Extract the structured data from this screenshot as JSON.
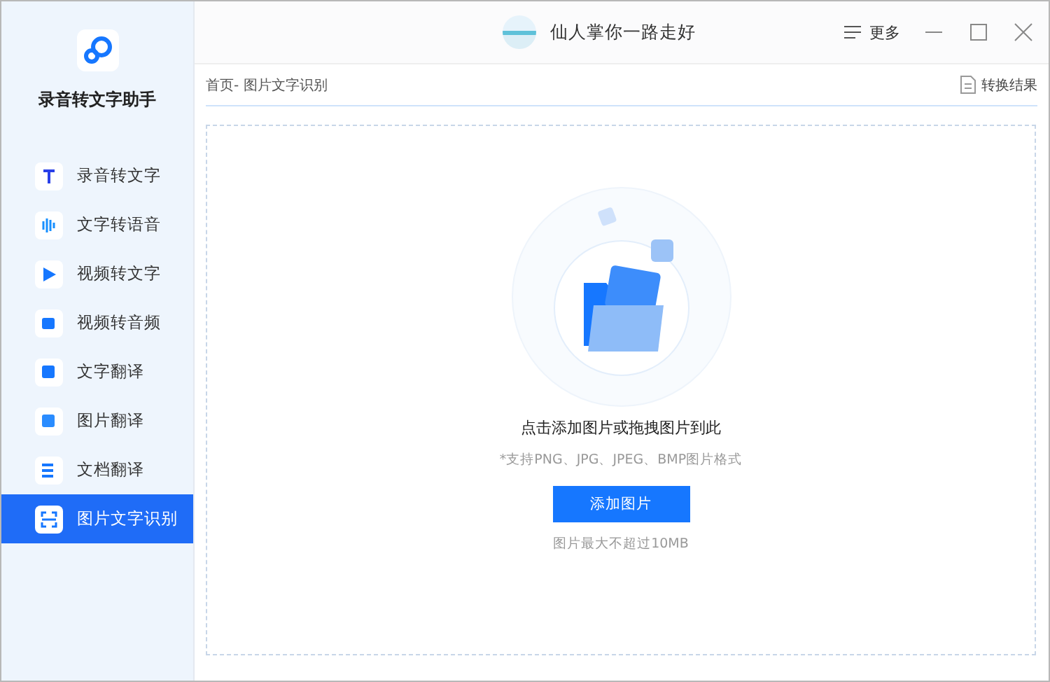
{
  "app": {
    "name": "录音转文字助手"
  },
  "sidebar": {
    "items": [
      {
        "label": "录音转文字",
        "selected": false
      },
      {
        "label": "文字转语音",
        "selected": false
      },
      {
        "label": "视频转文字",
        "selected": false
      },
      {
        "label": "视频转音频",
        "selected": false
      },
      {
        "label": "文字翻译",
        "selected": false
      },
      {
        "label": "图片翻译",
        "selected": false
      },
      {
        "label": "文档翻译",
        "selected": false
      },
      {
        "label": "图片文字识别",
        "selected": true
      }
    ]
  },
  "titlebar": {
    "user": "仙人掌你一路走好",
    "more": "更多"
  },
  "breadcrumb": "首页- 图片文字识别",
  "results_link": "转换结果",
  "upload": {
    "prompt": "点击添加图片或拖拽图片到此",
    "formats": "*支持PNG、JPG、JPEG、BMP图片格式",
    "button": "添加图片",
    "limit": "图片最大不超过10MB"
  }
}
